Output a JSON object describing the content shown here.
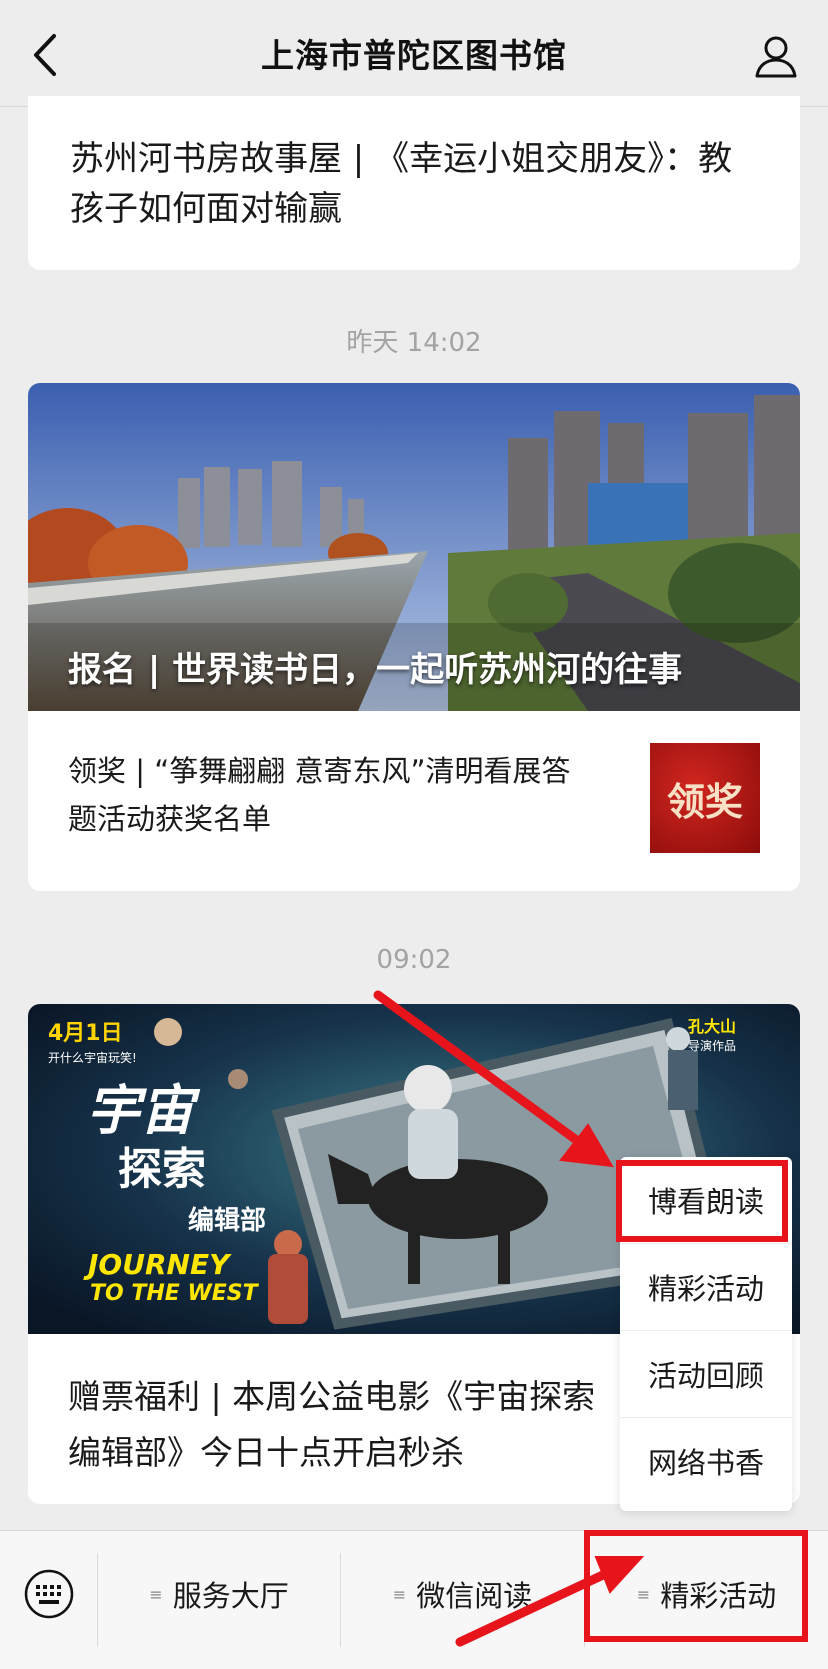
{
  "header": {
    "title": "上海市普陀区图书馆",
    "back_icon": "chevron-left-icon",
    "profile_icon": "user-icon"
  },
  "messages": {
    "article_top": {
      "title": "苏州河书房故事屋 | 《幸运小姐交朋友》：教孩子如何面对输赢"
    },
    "time_1": "昨天 14:02",
    "article_1": {
      "cover_title": "报名 | 世界读书日，一起听苏州河的往事",
      "sub_title": "领奖 | “筝舞翩翩 意寄东风”清明看展答题活动获奖名单",
      "thumb_text": "领奖"
    },
    "time_2": "09:02",
    "article_2": {
      "poster_date": "4月1日",
      "poster_tagline": "开什么宇宙玩笑!",
      "poster_title_1": "宇宙",
      "poster_title_2": "探索",
      "poster_title_3": "编辑部",
      "poster_en_1": "JOURNEY",
      "poster_en_2": "TO THE WEST",
      "poster_director": "孔大山",
      "poster_director_note": "导演作品",
      "sub_title": "赠票福利 | 本周公益电影《宇宙探索编辑部》今日十点开启秒杀"
    }
  },
  "popup_menu": {
    "items": [
      "博看朗读",
      "精彩活动",
      "活动回顾",
      "网络书香"
    ]
  },
  "tabbar": {
    "keyboard_icon": "keyboard-icon",
    "tabs": [
      "服务大厅",
      "微信阅读",
      "精彩活动"
    ]
  },
  "colors": {
    "annotation": "#e8141c",
    "background": "#ededed"
  }
}
